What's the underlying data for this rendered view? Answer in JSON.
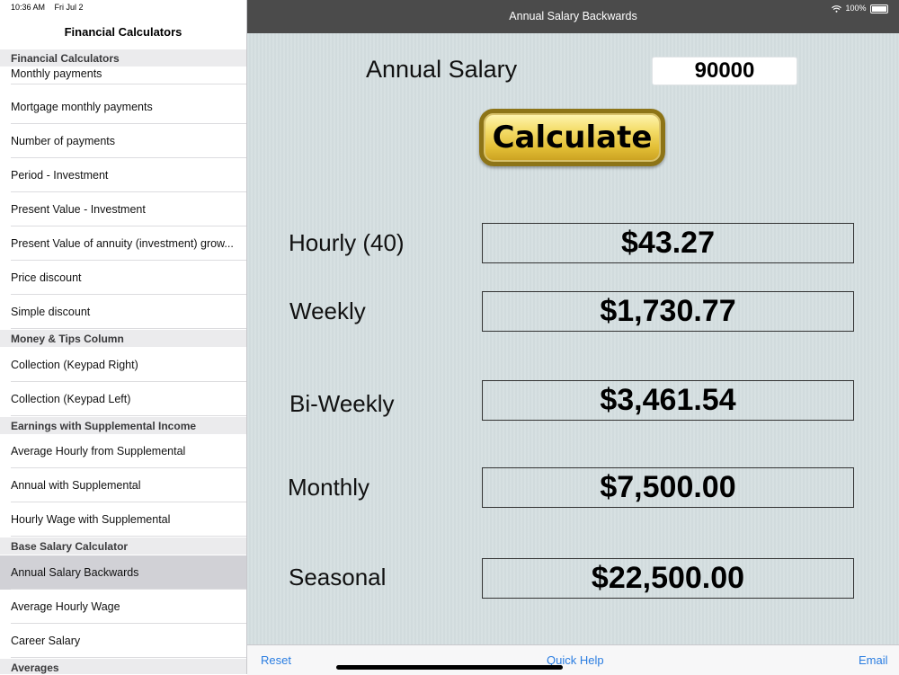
{
  "status": {
    "time": "10:36 AM",
    "date": "Fri Jul 2",
    "battery": "100%"
  },
  "sidebar": {
    "title": "Financial Calculators",
    "sections": {
      "s0": "Financial Calculators",
      "s1": "Money & Tips Column",
      "s2": "Earnings with Supplemental Income",
      "s3": "Base Salary Calculator",
      "s4": "Averages"
    },
    "items": [
      "Monthly payments",
      "Mortgage monthly payments",
      "Number of payments",
      "Period - Investment",
      "Present Value - Investment",
      "Present Value of annuity (investment) grow...",
      "Price discount",
      "Simple discount",
      "Collection (Keypad Right)",
      "Collection (Keypad Left)",
      "Average Hourly from Supplemental",
      "Annual with Supplemental",
      "Hourly Wage with Supplemental",
      "Annual Salary Backwards",
      "Average Hourly Wage",
      "Career Salary"
    ],
    "selected_item": "Annual Salary Backwards"
  },
  "nav": {
    "title": "Annual Salary Backwards"
  },
  "form": {
    "salary_label": "Annual Salary",
    "salary_value": "90000",
    "calculate_label": "Calculate"
  },
  "results": [
    {
      "label": "Hourly (40)",
      "value": "$43.27"
    },
    {
      "label": "Weekly",
      "value": "$1,730.77"
    },
    {
      "label": "Bi-Weekly",
      "value": "$3,461.54"
    },
    {
      "label": "Monthly",
      "value": "$7,500.00"
    },
    {
      "label": "Seasonal",
      "value": "$22,500.00"
    }
  ],
  "toolbar": {
    "reset": "Reset",
    "quick_help": "Quick Help",
    "email": "Email"
  },
  "colors": {
    "accent": "#2a7de1",
    "navbar": "#4b4b4b",
    "background": "#d5dfe1",
    "button_gold": "#e3bf36"
  }
}
